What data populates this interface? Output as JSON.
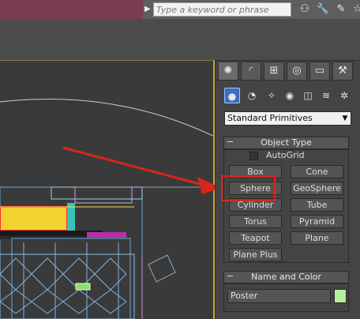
{
  "search": {
    "placeholder": "Type a keyword or phrase"
  },
  "toolbar_icons": [
    "binoculars-icon",
    "wrench-icon",
    "pin-icon",
    "star-icon"
  ],
  "command_panel": {
    "tabs": [
      {
        "name": "create",
        "icon": "sun-icon",
        "glyph": "✺",
        "active": true
      },
      {
        "name": "modify",
        "icon": "curve-icon",
        "glyph": "◜"
      },
      {
        "name": "hierarchy",
        "icon": "hierarchy-icon",
        "glyph": "⊞"
      },
      {
        "name": "motion",
        "icon": "motion-icon",
        "glyph": "◎"
      },
      {
        "name": "display",
        "icon": "monitor-icon",
        "glyph": "▭"
      },
      {
        "name": "utilities",
        "icon": "hammer-icon",
        "glyph": "⚒"
      }
    ],
    "categories": [
      {
        "name": "geometry",
        "glyph": "●",
        "active": true
      },
      {
        "name": "shapes",
        "glyph": "◔"
      },
      {
        "name": "lights",
        "glyph": "✧"
      },
      {
        "name": "cameras",
        "glyph": "◉"
      },
      {
        "name": "helpers",
        "glyph": "◫"
      },
      {
        "name": "spacewarps",
        "glyph": "≋"
      },
      {
        "name": "systems",
        "glyph": "✲"
      }
    ],
    "dropdown_value": "Standard Primitives",
    "object_type": {
      "title": "Object Type",
      "autogrid_label": "AutoGrid",
      "buttons": [
        "Box",
        "Cone",
        "Sphere",
        "GeoSphere",
        "Cylinder",
        "Tube",
        "Torus",
        "Pyramid",
        "Teapot",
        "Plane",
        "Plane Plus"
      ]
    },
    "name_and_color": {
      "title": "Name and Color",
      "name_value": "Poster",
      "swatch_color": "#b7ee9b"
    }
  },
  "colors": {
    "title_bar": "#7a3d4f",
    "viewport_border": "#c9a23a",
    "highlight": "#d9251c",
    "selection_wire": "#c8e0f0",
    "object_yellow": "#f2d22e",
    "object_magenta": "#b830a8"
  }
}
